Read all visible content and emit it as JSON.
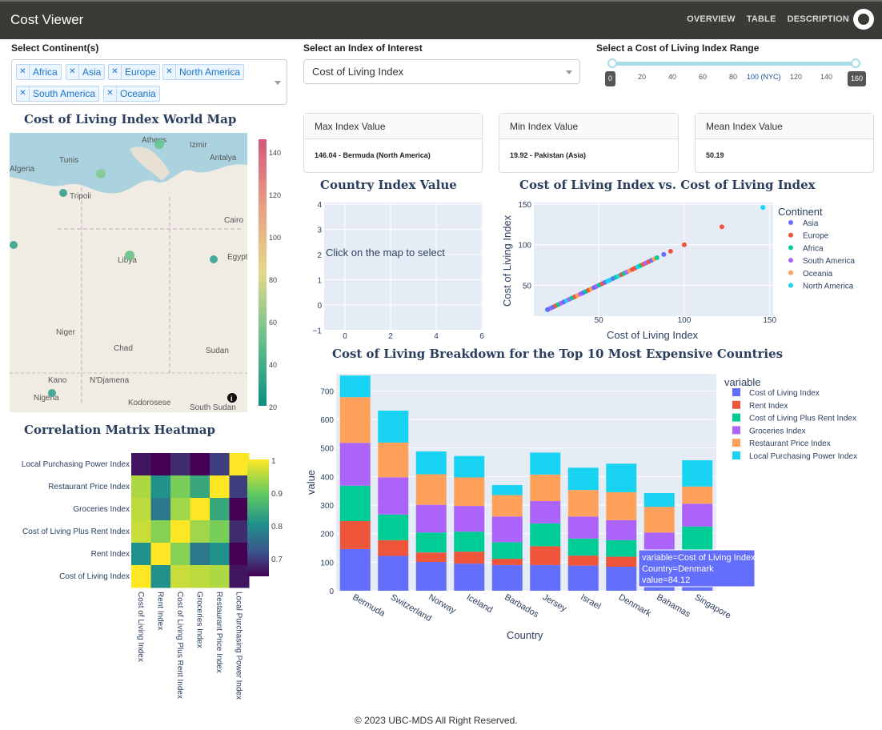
{
  "nav": {
    "brand": "Cost Viewer",
    "links": [
      "OVERVIEW",
      "TABLE",
      "DESCRIPTION"
    ]
  },
  "filters": {
    "continent_label": "Select Continent(s)",
    "continents": [
      "Africa",
      "Asia",
      "Europe",
      "North America",
      "South America",
      "Oceania"
    ],
    "index_label": "Select an Index of Interest",
    "index_selected": "Cost of Living Index",
    "range_label": "Select a Cost of Living Index Range",
    "range_min": 0,
    "range_max": 160,
    "range_marks": [
      "0",
      "20",
      "40",
      "60",
      "80",
      "100 (NYC)",
      "120",
      "140",
      "160"
    ]
  },
  "stats": {
    "max_title": "Max Index Value",
    "max_value": "146.04 - Bermuda (North America)",
    "min_title": "Min Index Value",
    "min_value": "19.92 - Pakistan (Asia)",
    "mean_title": "Mean Index Value",
    "mean_value": "50.19"
  },
  "map": {
    "title": "Cost of Living Index World Map",
    "colorbar_ticks": [
      "140",
      "120",
      "100",
      "80",
      "60",
      "40",
      "20"
    ],
    "places": [
      "Tunis",
      "Athens",
      "Izmir",
      "Antalya",
      "Algeria",
      "Tripoli",
      "Cairo",
      "Egypt",
      "Libya",
      "Niger",
      "Chad",
      "Sudan",
      "Kano",
      "N'Djamena",
      "Nigeria",
      "Kodorosese",
      "South Sudan"
    ]
  },
  "heatmap": {
    "title": "Correlation Matrix Heatmap",
    "labels": [
      "Cost of Living Index",
      "Rent Index",
      "Cost of Living Plus Rent Index",
      "Groceries Index",
      "Restaurant Price Index",
      "Local Purchasing Power Index"
    ],
    "colorbar_ticks": [
      "1",
      "0.9",
      "0.8",
      "0.7"
    ],
    "matrix": [
      [
        1.0,
        0.78,
        0.96,
        0.95,
        0.94,
        0.62
      ],
      [
        0.78,
        1.0,
        0.91,
        0.74,
        0.78,
        0.6
      ],
      [
        0.96,
        0.91,
        1.0,
        0.93,
        0.9,
        0.64
      ],
      [
        0.95,
        0.74,
        0.93,
        1.0,
        0.82,
        0.57
      ],
      [
        0.94,
        0.78,
        0.9,
        0.82,
        1.0,
        0.66
      ],
      [
        0.62,
        0.6,
        0.64,
        0.57,
        0.66,
        1.0
      ]
    ]
  },
  "country_chart": {
    "title": "Country Index Value",
    "message": "Click on the map to select",
    "x_ticks": [
      "0",
      "2",
      "4",
      "6"
    ],
    "y_ticks": [
      "4",
      "3",
      "2",
      "1",
      "0",
      "−1"
    ]
  },
  "scatter": {
    "title": "Cost of Living Index vs. Cost of Living Index",
    "xlabel": "Cost of Living Index",
    "ylabel": "Cost of Living Index",
    "legend_title": "Continent",
    "legend": [
      {
        "name": "Asia",
        "color": "#636efa"
      },
      {
        "name": "Europe",
        "color": "#ef553b"
      },
      {
        "name": "Africa",
        "color": "#00cc96"
      },
      {
        "name": "South America",
        "color": "#ab63fa"
      },
      {
        "name": "Oceania",
        "color": "#ffa15a"
      },
      {
        "name": "North America",
        "color": "#19d3f3"
      }
    ]
  },
  "chart_data": {
    "type": "bar",
    "title": "Cost of Living Breakdown for the Top 10 Most Expensive Countries",
    "xlabel": "Country",
    "ylabel": "value",
    "ylim": [
      0,
      760
    ],
    "legend_title": "variable",
    "categories": [
      "Bermuda",
      "Switzerland",
      "Norway",
      "Iceland",
      "Barbados",
      "Jersey",
      "Israel",
      "Denmark",
      "Bahamas",
      "Singapore"
    ],
    "series": [
      {
        "name": "Cost of Living Index",
        "color": "#636efa",
        "values": [
          146.04,
          122,
          101,
          95,
          90,
          90,
          88,
          84.12,
          84,
          85
        ]
      },
      {
        "name": "Rent Index",
        "color": "#ef553b",
        "values": [
          98,
          55,
          33,
          42,
          22,
          66,
          35,
          35,
          0,
          0
        ]
      },
      {
        "name": "Cost of Living Plus Rent Index",
        "color": "#00cc96",
        "values": [
          124,
          90,
          70,
          70,
          58,
          80,
          60,
          58,
          45,
          140
        ]
      },
      {
        "name": "Groceries Index",
        "color": "#ab63fa",
        "values": [
          150,
          130,
          97,
          90,
          90,
          78,
          77,
          70,
          75,
          80
        ]
      },
      {
        "name": "Restaurant Price Index",
        "color": "#ffa15a",
        "values": [
          160,
          122,
          107,
          100,
          75,
          93,
          93,
          98,
          90,
          60
        ]
      },
      {
        "name": "Local Purchasing Power Index",
        "color": "#19d3f3",
        "values": [
          76,
          112,
          80,
          75,
          35,
          77,
          78,
          100,
          48,
          92
        ]
      }
    ],
    "tooltip": {
      "variable": "variable=Cost of Living Index",
      "country": "Country=Denmark",
      "value": "value=84.12"
    }
  },
  "footer": "© 2023 UBC-MDS All Right Reserved."
}
